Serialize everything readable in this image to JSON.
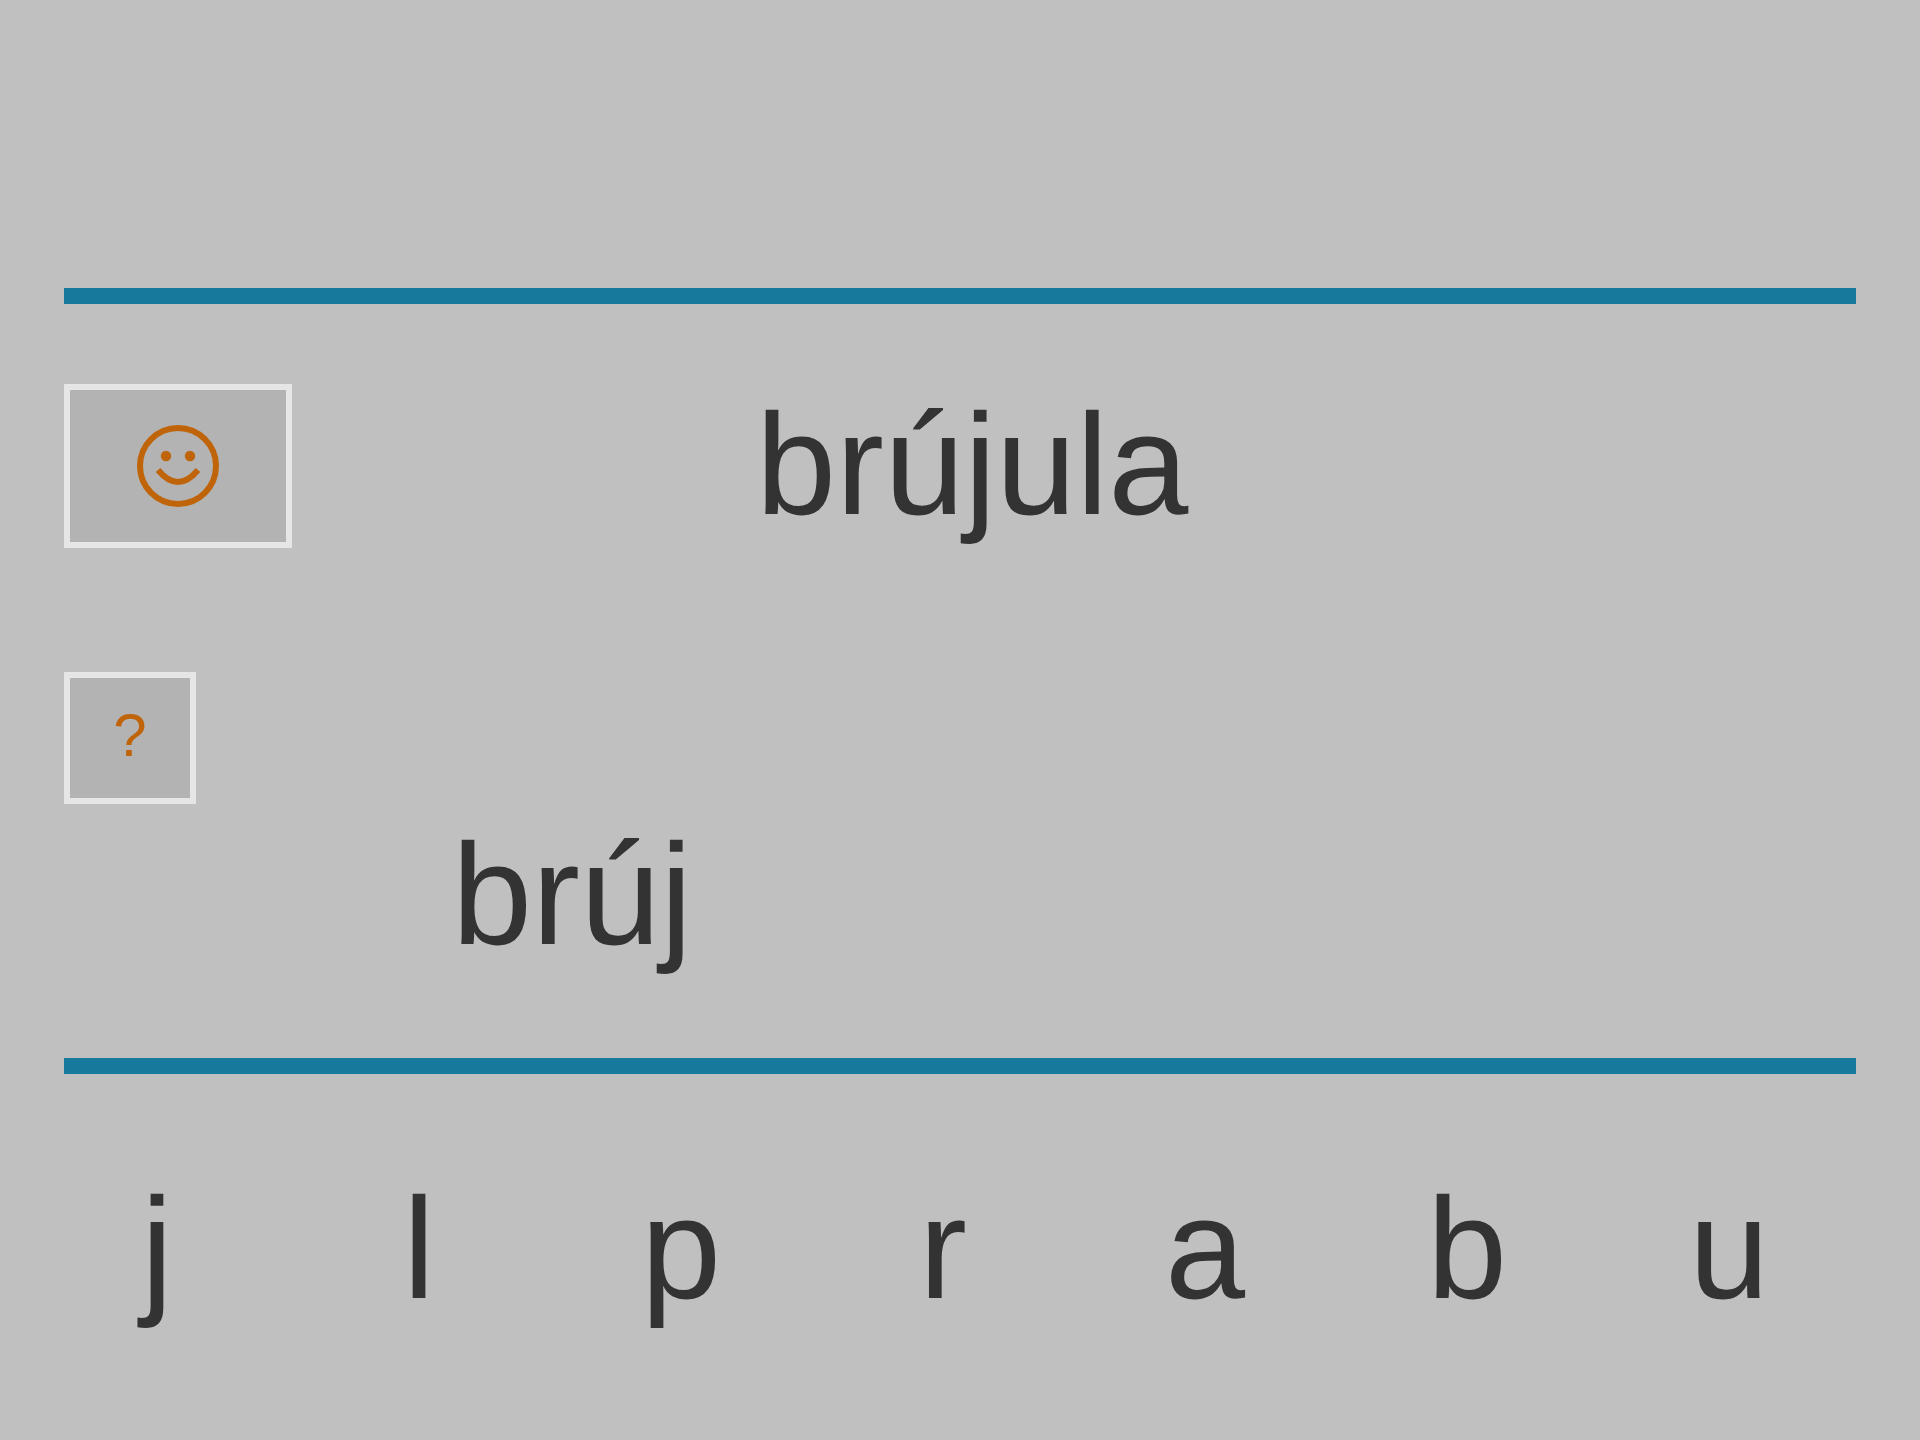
{
  "answer_button": {
    "kind": "smiley"
  },
  "word": "brújula",
  "hint_button": {
    "label": "?"
  },
  "typed": "brúj",
  "letters": [
    {
      "label": "j"
    },
    {
      "label": "l"
    },
    {
      "label": "p"
    },
    {
      "label": "r"
    },
    {
      "label": "a"
    },
    {
      "label": "b"
    },
    {
      "label": "u"
    }
  ]
}
